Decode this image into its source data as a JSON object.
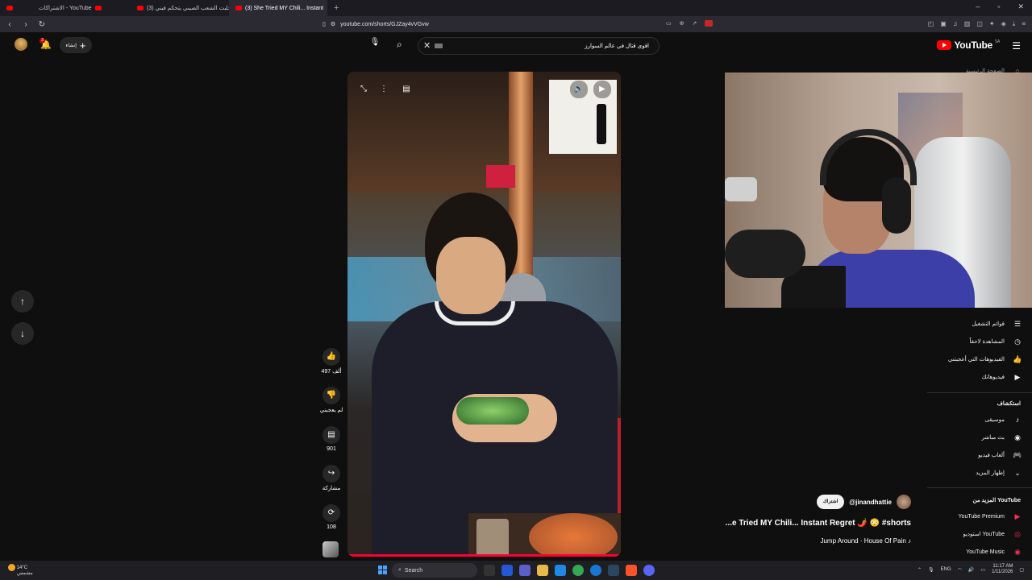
{
  "browser": {
    "tabs": [
      {
        "label": "",
        "active": false
      },
      {
        "label": "الاشتراكات - YouTube",
        "active": false
      },
      {
        "label": "(3) خليت الشعب الصيني يتحكم فيني !!",
        "active": false
      },
      {
        "label": "(3) She Tried MY Chili... Instant",
        "active": true
      }
    ],
    "url": "youtube.com/shorts/GJZay4vVGvw",
    "new_tab_symbol": "+"
  },
  "header": {
    "logo_text": "YouTube",
    "logo_country": "SA",
    "search_query": "اقوى قتال في عالم السوارز",
    "create_label": "إنشاء",
    "notification_count": "3"
  },
  "shorts": {
    "likes": "497 ألف",
    "dislike_label": "لم يعجبني",
    "comments": "901",
    "share_label": "مشاركة",
    "remix_count": "108",
    "channel_handle": "@jinandhattie",
    "subscribe_label": "اشتراك",
    "title": "...e Tried MY Chili... Instant Regret 🌶️ 😳 #shorts",
    "sound": "Jump Around · House Of Pain",
    "progress": 1.0
  },
  "sidebar": {
    "home_label": "الصفحة الرئيسية",
    "you_items": [
      {
        "label": "قوائم التشغيل",
        "icon": "playlist-icon",
        "glyph": "☰"
      },
      {
        "label": "المشاهدة لاحقاً",
        "icon": "clock-icon",
        "glyph": "◷"
      },
      {
        "label": "الفيديوهات التي أعجبتني",
        "icon": "like-icon",
        "glyph": "👍"
      },
      {
        "label": "فيديوهاتك",
        "icon": "video-icon",
        "glyph": "▶"
      }
    ],
    "explore_header": "استكشاف",
    "explore_items": [
      {
        "label": "موسيقى",
        "icon": "music-icon",
        "glyph": "♪"
      },
      {
        "label": "بث مباشر",
        "icon": "live-icon",
        "glyph": "◉"
      },
      {
        "label": "ألعاب فيديو",
        "icon": "gaming-icon",
        "glyph": "🎮"
      },
      {
        "label": "إظهار المزيد",
        "icon": "chevron-down-icon",
        "glyph": "⌄"
      }
    ],
    "more_header": "المزيد من YouTube",
    "more_items": [
      {
        "label": "YouTube Premium",
        "icon": "premium-icon",
        "glyph": "▶"
      },
      {
        "label": "استوديو YouTube",
        "icon": "studio-icon",
        "glyph": "◎"
      },
      {
        "label": "YouTube Music",
        "icon": "music-app-icon",
        "glyph": "◉"
      }
    ]
  },
  "taskbar": {
    "weather_temp": "14°C",
    "weather_desc": "مشمس",
    "search_label": "Search",
    "lang": "ENG",
    "time": "11:17 AM",
    "date": "1/11/2026"
  },
  "colors": {
    "accent": "#ff0033",
    "background": "#0f0f0f"
  }
}
